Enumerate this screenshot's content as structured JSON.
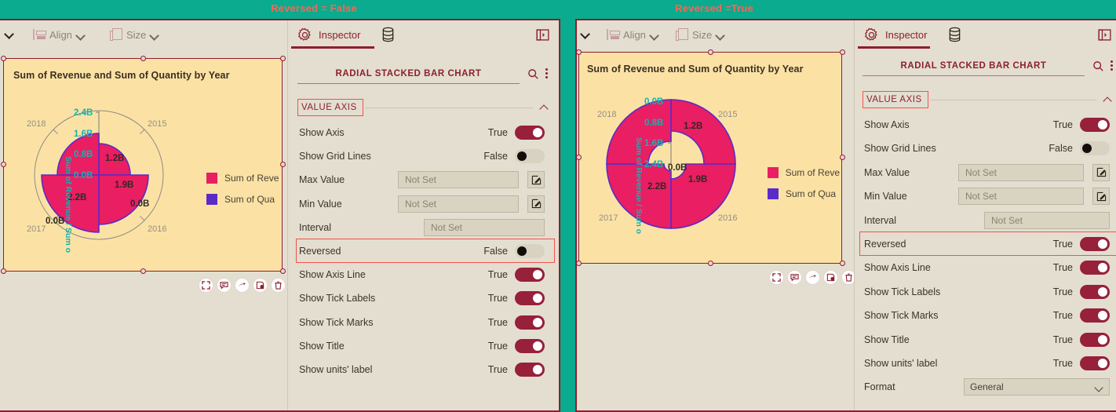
{
  "banners": {
    "left": "Reversed = False",
    "right": "Reversed =True",
    "bg_color": "#0aab8e",
    "text_color": "#ef6a5a"
  },
  "toolbar": {
    "align_label": "Align",
    "size_label": "Size"
  },
  "inspector": {
    "tab_label": "Inspector",
    "panel_title": "RADIAL STACKED BAR CHART",
    "section_title": "VALUE AXIS",
    "search_icon": "search-icon",
    "overflow_icon": "more-vertical-icon",
    "rows_left": [
      {
        "label": "Show Axis",
        "type": "toggle",
        "value": "True"
      },
      {
        "label": "Show Grid Lines",
        "type": "toggle",
        "value": "False"
      },
      {
        "label": "Max Value",
        "type": "field",
        "value": "Not Set"
      },
      {
        "label": "Min Value",
        "type": "field",
        "value": "Not Set"
      },
      {
        "label": "Interval",
        "type": "field-noedit",
        "value": "Not Set"
      },
      {
        "label": "Reversed",
        "type": "toggle",
        "value": "False",
        "highlight": true
      },
      {
        "label": "Show Axis Line",
        "type": "toggle",
        "value": "True"
      },
      {
        "label": "Show Tick Labels",
        "type": "toggle",
        "value": "True"
      },
      {
        "label": "Show Tick Marks",
        "type": "toggle",
        "value": "True"
      },
      {
        "label": "Show Title",
        "type": "toggle",
        "value": "True"
      },
      {
        "label": "Show units' label",
        "type": "toggle",
        "value": "True"
      }
    ],
    "rows_right": [
      {
        "label": "Show Axis",
        "type": "toggle",
        "value": "True"
      },
      {
        "label": "Show Grid Lines",
        "type": "toggle",
        "value": "False"
      },
      {
        "label": "Max Value",
        "type": "field",
        "value": "Not Set"
      },
      {
        "label": "Min Value",
        "type": "field",
        "value": "Not Set"
      },
      {
        "label": "Interval",
        "type": "field-noedit",
        "value": "Not Set"
      },
      {
        "label": "Reversed",
        "type": "toggle",
        "value": "True",
        "highlight": true
      },
      {
        "label": "Show Axis Line",
        "type": "toggle",
        "value": "True"
      },
      {
        "label": "Show Tick Labels",
        "type": "toggle",
        "value": "True"
      },
      {
        "label": "Show Tick Marks",
        "type": "toggle",
        "value": "True"
      },
      {
        "label": "Show Title",
        "type": "toggle",
        "value": "True"
      },
      {
        "label": "Show units' label",
        "type": "toggle",
        "value": "True"
      },
      {
        "label": "Format",
        "type": "select",
        "value": "General"
      }
    ]
  },
  "card_actions": [
    "expand-icon",
    "comment-icon",
    "share-icon",
    "save-icon",
    "delete-icon"
  ],
  "chart_data": [
    {
      "id": "left",
      "type": "bar",
      "subtype": "radial-stacked-bar",
      "title": "Sum of Revenue and Sum of Quantity by Year",
      "reversed": false,
      "categories": [
        "2015",
        "2016",
        "2017",
        "2018"
      ],
      "series": [
        {
          "name": "Sum of Revenue",
          "color": "#e91e63",
          "values": [
            1.2,
            1.9,
            2.2,
            1.6
          ]
        },
        {
          "name": "Sum of Quantity",
          "color": "#5b2bc8",
          "values": [
            0.0,
            0.0,
            0.0,
            0.0
          ]
        }
      ],
      "data_labels": [
        "1.2B",
        "1.9B",
        "0.0B",
        "2.2B",
        "0.0B"
      ],
      "category_labels": [
        "2015",
        "2016",
        "2017",
        "2018"
      ],
      "value_axis": {
        "title": "Sum of Revenue / Sum o",
        "tick_labels": [
          "0.0B",
          "0.8B",
          "1.6B",
          "2.4B"
        ],
        "tick_order": "inside-out",
        "range": [
          0,
          2.4
        ],
        "label_color": "#14b3b0"
      },
      "legend": {
        "position": "right",
        "entries": [
          "Sum of Reve",
          "Sum of Qua"
        ]
      },
      "grid": false,
      "plot_bg": "#fbe2a4"
    },
    {
      "id": "right",
      "type": "bar",
      "subtype": "radial-stacked-bar",
      "title": "Sum of Revenue and Sum of Quantity by Year",
      "reversed": true,
      "categories": [
        "2015",
        "2016",
        "2017",
        "2018"
      ],
      "series": [
        {
          "name": "Sum of Revenue",
          "color": "#e91e63",
          "values": [
            1.2,
            1.9,
            2.2,
            1.6
          ]
        },
        {
          "name": "Sum of Quantity",
          "color": "#5b2bc8",
          "values": [
            0.0,
            0.0,
            0.0,
            0.0
          ]
        }
      ],
      "data_labels": [
        "1.2B",
        "1.9B",
        "0.0B",
        "2.2B"
      ],
      "category_labels": [
        "2015",
        "2016",
        "2017",
        "2018"
      ],
      "value_axis": {
        "title": "Sum of Revenue / Sum o",
        "tick_labels": [
          "0.0B",
          "0.8B",
          "1.6B",
          "2.4B"
        ],
        "tick_order": "outside-in",
        "range": [
          0,
          2.4
        ],
        "label_color": "#14b3b0"
      },
      "legend": {
        "position": "right",
        "entries": [
          "Sum of Reve",
          "Sum of Qua"
        ]
      },
      "grid": false,
      "plot_bg": "#fbe2a4"
    }
  ]
}
